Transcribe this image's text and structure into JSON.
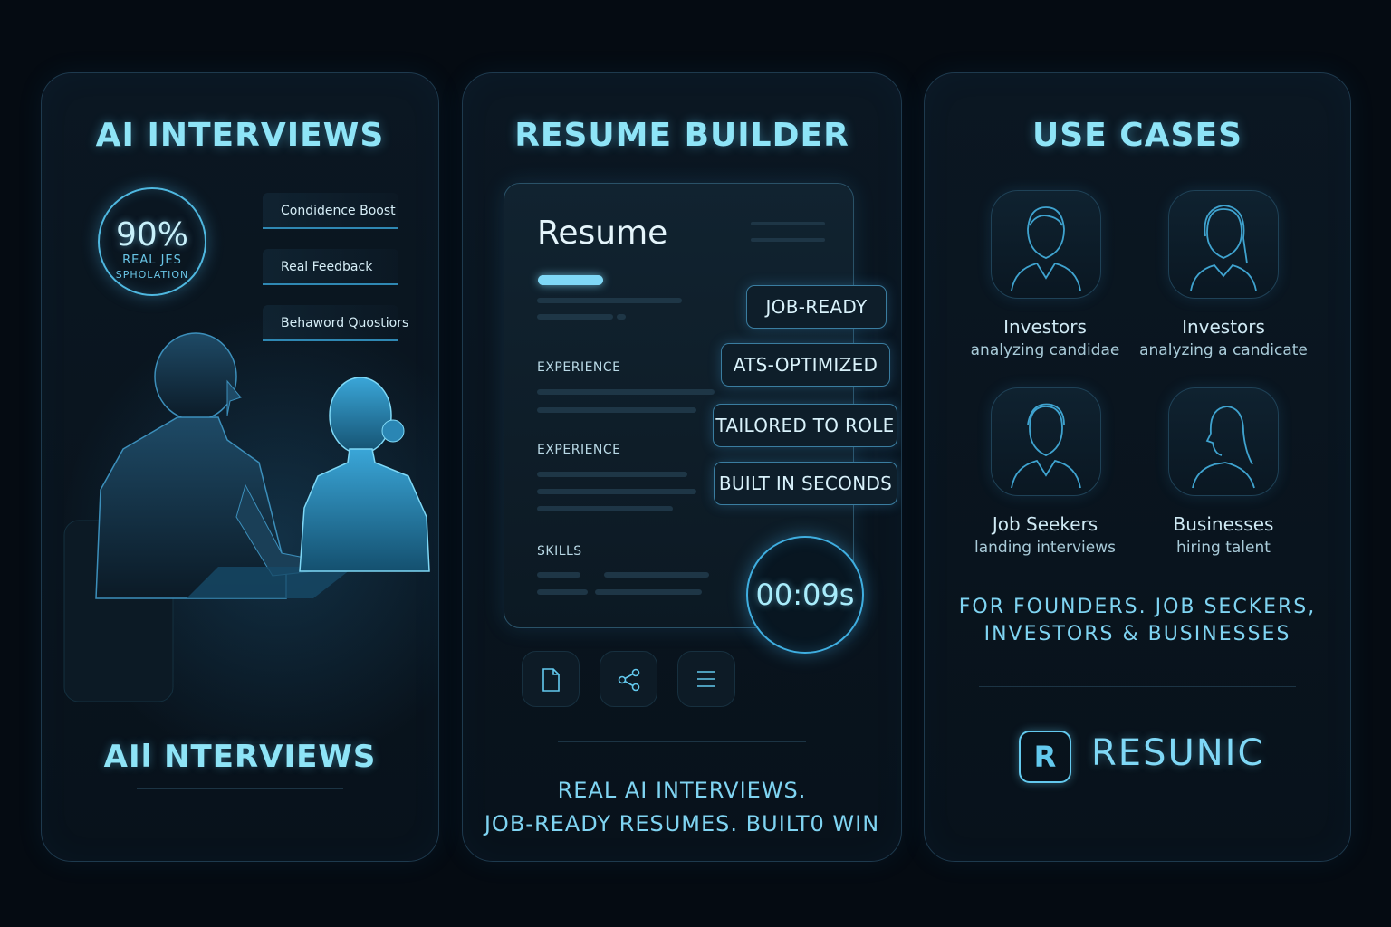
{
  "colors": {
    "accent": "#7fd8f6",
    "background": "#050b12",
    "panel_border": "#1e3a4e"
  },
  "interviews": {
    "title": "AI INTERVIEWS",
    "stat": {
      "value": "90%",
      "line1": "REAL JES",
      "line2": "SPHOLATION"
    },
    "features": [
      "Condidence Boost",
      "Real Feedback",
      "Behaword Quostiors"
    ],
    "bottom_title": "AIl NTERVIEWS"
  },
  "resume": {
    "title": "RESUME BUILDER",
    "card_title": "Resume",
    "sections": [
      "EXPERIENCE",
      "EXPERIENCE",
      "SKILLS"
    ],
    "tags": [
      "JOB-READY",
      "ATS-OPTIMIZED",
      "TAILORED TO ROLE",
      "BUILT IN SECONDS"
    ],
    "timer": "00:09s",
    "actions": [
      "document-icon",
      "share-icon",
      "menu-icon"
    ],
    "footer_line1": "REAL AI INTERVIEWS.",
    "footer_line2": "JOB-READY RESUMES. BUILT0 WIN"
  },
  "usecases": {
    "title": "USE CASES",
    "items": [
      {
        "line1": "Investors",
        "line2": "analyzing candidae",
        "icon": "man-avatar-icon"
      },
      {
        "line1": "Investors",
        "line2": "analyzing a candicate",
        "icon": "woman-avatar-icon"
      },
      {
        "line1": "Job Seekers",
        "line2": "landing interviews",
        "icon": "man-avatar-icon"
      },
      {
        "line1": "Businesses",
        "line2": "hiring talent",
        "icon": "woman-profile-icon"
      }
    ],
    "tagline_line1": "FOR FOUNDERS. JOB SECKERS,",
    "tagline_line2": "INVESTORS & BUSINESSES",
    "brand_letter": "R",
    "brand_name": "RESUNIC"
  }
}
